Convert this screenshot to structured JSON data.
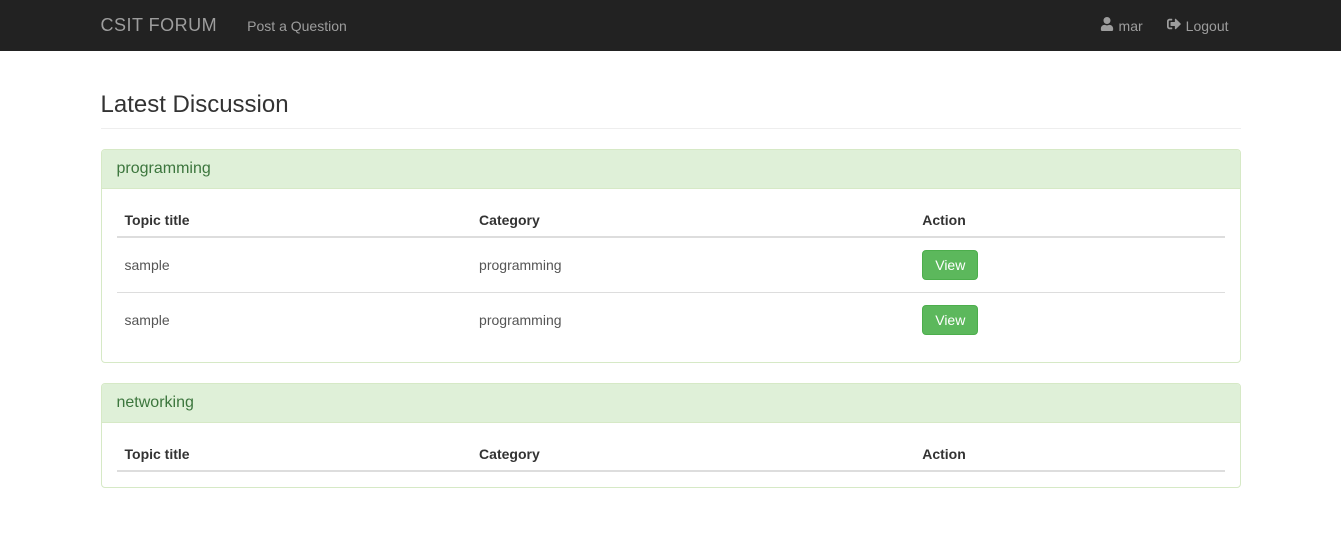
{
  "navbar": {
    "brand": "CSIT FORUM",
    "post_link": "Post a Question",
    "user_label": "mar",
    "logout_label": "Logout"
  },
  "header": {
    "title": "Latest Discussion"
  },
  "table_headers": {
    "title": "Topic title",
    "category": "Category",
    "action": "Action"
  },
  "buttons": {
    "view": "View"
  },
  "panels": [
    {
      "title": "programming",
      "rows": [
        {
          "title": "sample",
          "category": "programming"
        },
        {
          "title": "sample",
          "category": "programming"
        }
      ]
    },
    {
      "title": "networking",
      "rows": []
    }
  ]
}
